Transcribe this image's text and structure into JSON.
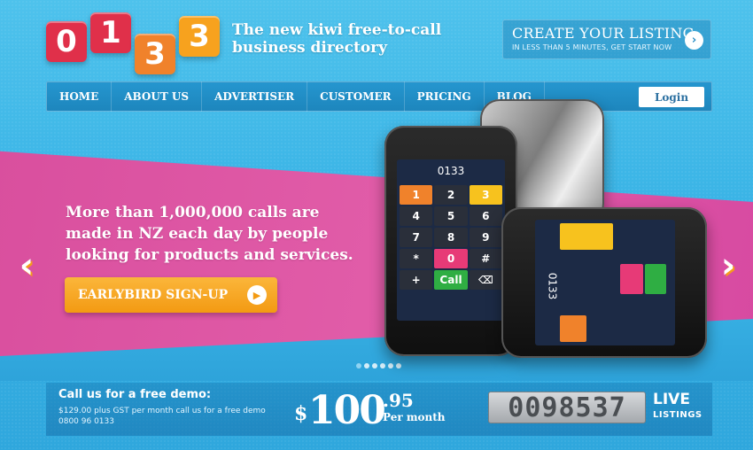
{
  "logo": {
    "digits": [
      "0",
      "1",
      "3",
      "3"
    ],
    "colors": [
      "#e0304a",
      "#e0304a",
      "#f0822b",
      "#f7a21e"
    ]
  },
  "tagline": "The new kiwi free-to-call business directory",
  "cta": {
    "title": "CREATE YOUR LISTING",
    "subtitle": "IN LESS THAN 5 MINUTES, GET START NOW",
    "arrow": "›"
  },
  "nav": {
    "items": [
      "HOME",
      "ABOUT US",
      "ADVERTISER",
      "CUSTOMER",
      "PRICING",
      "BLOG"
    ],
    "login": "Login"
  },
  "hero": {
    "headline": "More than 1,000,000 calls are made in NZ each day by people looking for products and services.",
    "signup_label": "EARLYBIRD SIGN-UP",
    "prev_arrow": "‹",
    "next_arrow": "›",
    "slide_count": 6
  },
  "phone_front": {
    "display": "0133",
    "keys": [
      "1",
      "2",
      "3",
      "4",
      "5",
      "6",
      "7",
      "8",
      "9",
      "*",
      "0",
      "#"
    ],
    "call": "Call"
  },
  "phone_side": {
    "display": "0133"
  },
  "footer": {
    "call_title": "Call us for a free demo:",
    "call_line1": "$129.00 plus GST per month call us for a free demo",
    "call_line2": "0800 96 0133",
    "price_dollar": "$",
    "price_main": "100",
    "price_cents": ".95",
    "price_per": "Per month",
    "counter": "0098537",
    "live": "LIVE",
    "listings": "LISTINGS"
  }
}
